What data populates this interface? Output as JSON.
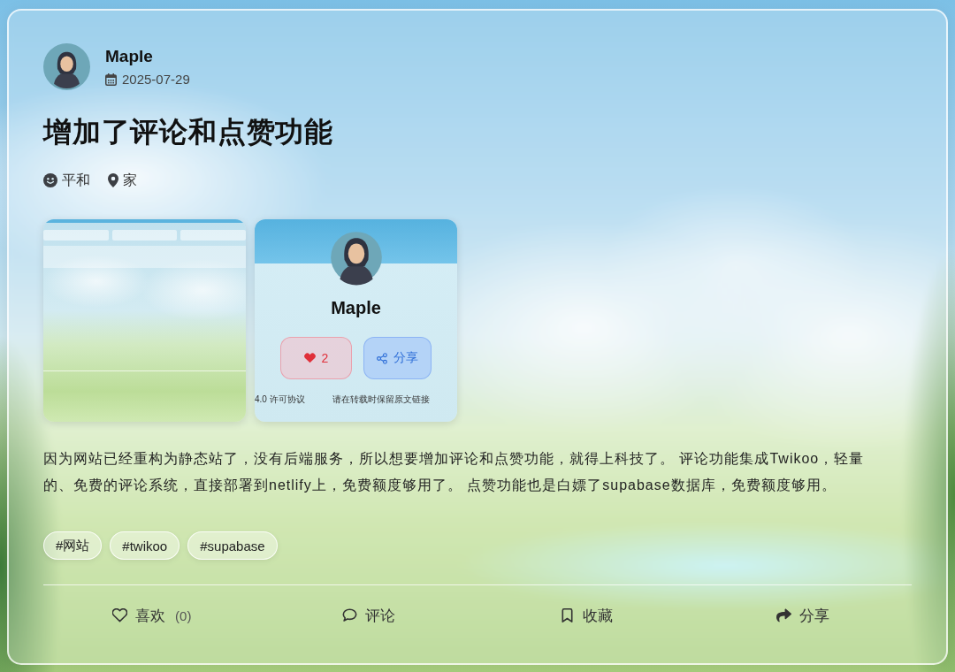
{
  "post": {
    "author": {
      "name": "Maple"
    },
    "date": "2025-07-29",
    "title": "增加了评论和点赞功能",
    "meta": [
      {
        "kind": "mood",
        "text": "平和"
      },
      {
        "kind": "location",
        "text": "家"
      }
    ],
    "images": [
      {
        "kind": "form-screenshot"
      },
      {
        "kind": "profile-screenshot",
        "name": "Maple",
        "likes": "2",
        "share_label": "分享",
        "footer": [
          "4.0 许可协议",
          "请在转载时保留原文链接"
        ]
      }
    ],
    "body": "因为网站已经重构为静态站了，没有后端服务，所以想要增加评论和点赞功能，就得上科技了。 评论功能集成Twikoo，轻量的、免费的评论系统，直接部署到netlify上，免费额度够用了。 点赞功能也是白嫖了supabase数据库，免费额度够用。",
    "tags": [
      "#网站",
      "#twikoo",
      "#supabase"
    ],
    "actions": [
      {
        "kind": "like",
        "label": "喜欢",
        "count": "(0)"
      },
      {
        "kind": "comment",
        "label": "评论"
      },
      {
        "kind": "bookmark",
        "label": "收藏"
      },
      {
        "kind": "share",
        "label": "分享"
      }
    ]
  }
}
